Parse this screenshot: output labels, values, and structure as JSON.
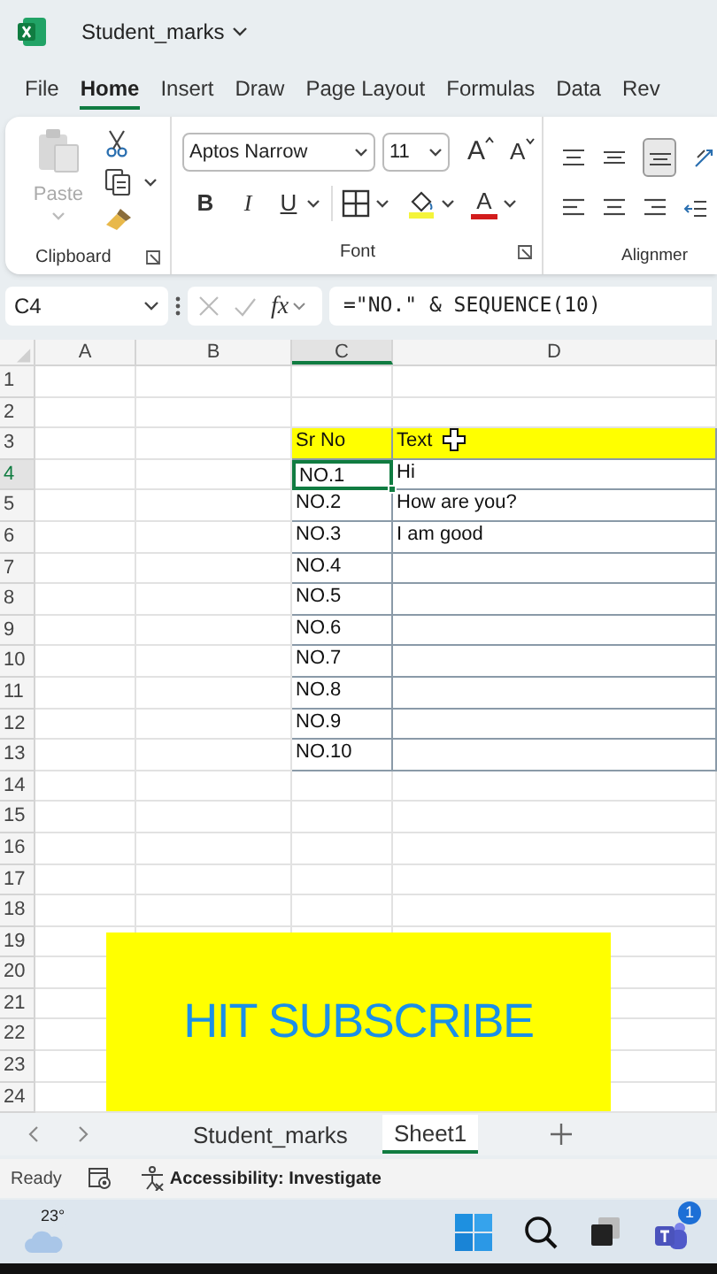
{
  "window": {
    "title": "Student_marks"
  },
  "menu_tabs": [
    {
      "label": "File",
      "selected": false
    },
    {
      "label": "Home",
      "selected": true
    },
    {
      "label": "Insert",
      "selected": false
    },
    {
      "label": "Draw",
      "selected": false
    },
    {
      "label": "Page Layout",
      "selected": false
    },
    {
      "label": "Formulas",
      "selected": false
    },
    {
      "label": "Data",
      "selected": false
    },
    {
      "label": "Rev",
      "selected": false
    }
  ],
  "ribbon": {
    "paste": {
      "label": "Paste",
      "disabled": true
    },
    "font_name": "Aptos Narrow",
    "font_size": "11",
    "grow_font": "A",
    "shrink_font": "A",
    "bold": "B",
    "italic": "I",
    "underline": "U",
    "font_color": "A",
    "groups": [
      "Clipboard",
      "Font",
      "Alignmer"
    ]
  },
  "formula_bar": {
    "name_box": "C4",
    "fx": "fx",
    "formula": "=\"NO.\" & SEQUENCE(10)"
  },
  "grid": {
    "columns": [
      {
        "label": "A",
        "selected": false
      },
      {
        "label": "B",
        "selected": false
      },
      {
        "label": "C",
        "selected": true
      },
      {
        "label": "D",
        "selected": false
      }
    ],
    "rows": [
      {
        "number": "1",
        "selected": false
      },
      {
        "number": "2",
        "selected": false
      },
      {
        "number": "3",
        "selected": false,
        "header": true,
        "c": {
          "text": "Sr No",
          "selected": false
        },
        "d": {
          "text": "Text",
          "selected": false
        }
      },
      {
        "number": "4",
        "selected": true,
        "c": {
          "text": "NO.1",
          "selected": true
        },
        "d": {
          "text": "Hi",
          "selected": false
        }
      },
      {
        "number": "5",
        "selected": false,
        "c": {
          "text": "NO.2",
          "selected": false
        },
        "d": {
          "text": "How are you?",
          "selected": false
        }
      },
      {
        "number": "6",
        "selected": false,
        "c": {
          "text": "NO.3",
          "selected": false
        },
        "d": {
          "text": "I am good",
          "selected": false
        }
      },
      {
        "number": "7",
        "selected": false,
        "c": {
          "text": "NO.4",
          "selected": false
        },
        "d": {
          "selected": false
        }
      },
      {
        "number": "8",
        "selected": false,
        "c": {
          "text": "NO.5",
          "selected": false
        },
        "d": {
          "selected": false
        }
      },
      {
        "number": "9",
        "selected": false,
        "c": {
          "text": "NO.6",
          "selected": false
        },
        "d": {
          "selected": false
        }
      },
      {
        "number": "10",
        "selected": false,
        "c": {
          "text": "NO.7",
          "selected": false
        },
        "d": {
          "selected": false
        }
      },
      {
        "number": "11",
        "selected": false,
        "c": {
          "text": "NO.8",
          "selected": false
        },
        "d": {
          "selected": false
        }
      },
      {
        "number": "12",
        "selected": false,
        "c": {
          "text": "NO.9",
          "selected": false
        },
        "d": {
          "selected": false
        }
      },
      {
        "number": "13",
        "selected": false,
        "c": {
          "text": "NO.10",
          "selected": false
        },
        "d": {
          "selected": false
        }
      },
      {
        "number": "14",
        "selected": false
      },
      {
        "number": "15",
        "selected": false
      },
      {
        "number": "16",
        "selected": false
      },
      {
        "number": "17",
        "selected": false
      },
      {
        "number": "18",
        "selected": false
      },
      {
        "number": "19",
        "selected": false
      },
      {
        "number": "20",
        "selected": false
      },
      {
        "number": "21",
        "selected": false
      },
      {
        "number": "22",
        "selected": false
      },
      {
        "number": "23",
        "selected": false
      },
      {
        "number": "24",
        "selected": false
      }
    ]
  },
  "overlay": {
    "text": "HIT SUBSCRIBE"
  },
  "sheet_tabs": [
    {
      "label": "Student_marks",
      "selected": false
    },
    {
      "label": "Sheet1",
      "selected": true
    }
  ],
  "status_bar": {
    "ready": "Ready",
    "accessibility": "Accessibility: Investigate"
  },
  "taskbar": {
    "temperature": "23°",
    "teams_badge": "1"
  }
}
